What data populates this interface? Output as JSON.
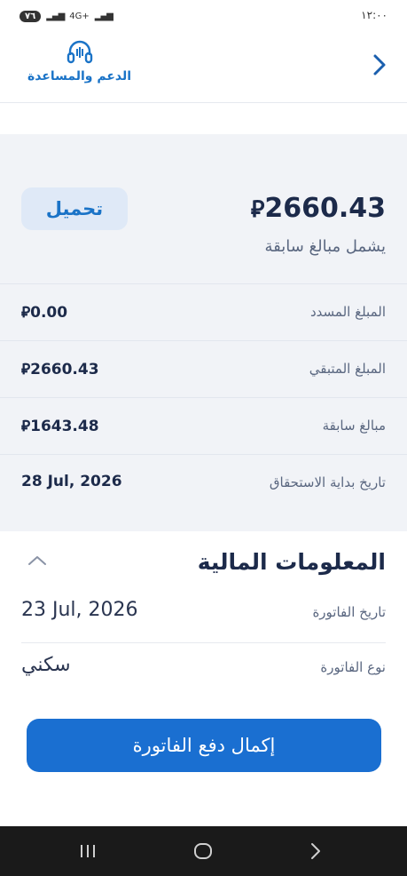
{
  "status_bar": {
    "battery": "٧٦",
    "network": "4G+",
    "time": "١٢:٠٠"
  },
  "header": {
    "support_label": "الدعم والمساعدة"
  },
  "summary": {
    "total_amount": "2660.43",
    "currency_symbol": "⃁",
    "download_label": "تحميل",
    "includes_label": "يشمل مبالغ سابقة",
    "rows": [
      {
        "label": "المبلغ المسدد",
        "value": "0.00"
      },
      {
        "label": "المبلغ المتبقي",
        "value": "2660.43"
      },
      {
        "label": "مبالغ سابقة",
        "value": "1643.48"
      },
      {
        "label": "تاريخ بداية الاستحقاق",
        "value": "28 Jul, 2026"
      }
    ]
  },
  "financial": {
    "title": "المعلومات المالية",
    "rows": [
      {
        "label": "تاريخ الفاتورة",
        "value": "23 Jul, 2026"
      },
      {
        "label": "نوع الفاتورة",
        "value": "سكني"
      }
    ],
    "pay_button_label": "إكمال دفع الفاتورة"
  },
  "colors": {
    "accent": "#1a6fd1",
    "text_dark": "#1c2a4a",
    "summary_bg": "#f1f3f7"
  }
}
